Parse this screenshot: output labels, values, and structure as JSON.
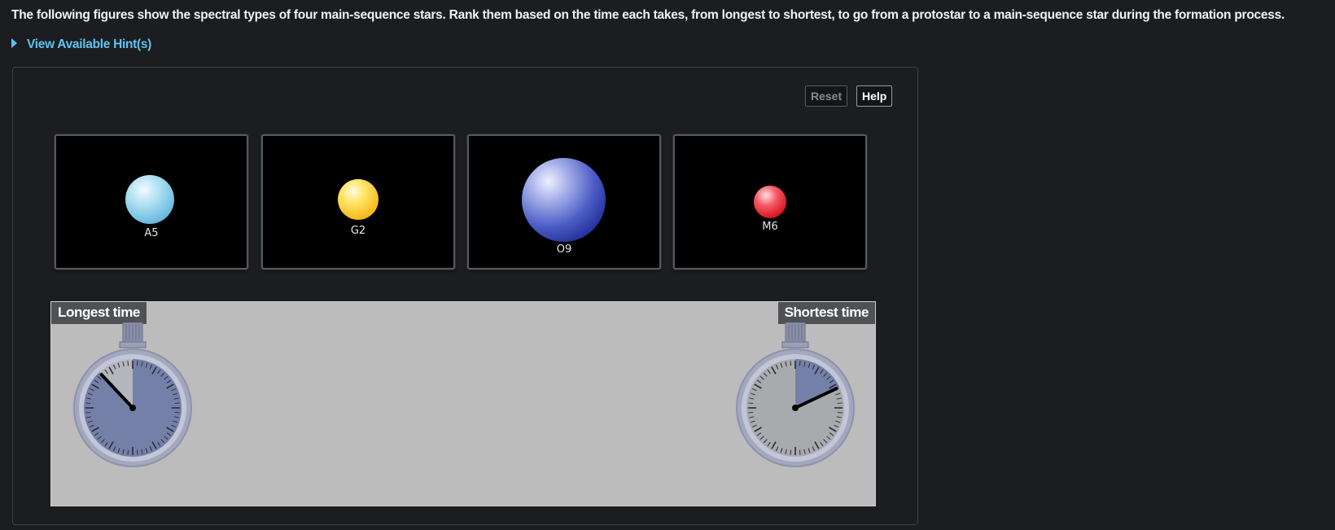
{
  "question": {
    "text": "The following figures show the spectral types of four main-sequence stars. Rank them based on the time each takes, from longest to shortest, to go from a protostar to a main-sequence star during the formation process."
  },
  "hint": {
    "label": "View Available Hint(s)",
    "icon": "triangle-right-icon",
    "color": "#5fc3ef"
  },
  "toolbar": {
    "reset_label": "Reset",
    "help_label": "Help"
  },
  "stars": [
    {
      "label": "A5",
      "color": "#8fd0ea"
    },
    {
      "label": "G2",
      "color": "#fcc82a"
    },
    {
      "label": "O9",
      "color": "#2a3aa8"
    },
    {
      "label": "M6",
      "color": "#e01f2a"
    }
  ],
  "ranking": {
    "left_label": "Longest time",
    "right_label": "Shortest time",
    "left_icon": "stopwatch-long-icon",
    "right_icon": "stopwatch-short-icon",
    "left_fill_fraction": 0.88,
    "right_fill_fraction": 0.18,
    "fill_color": "#7480a8"
  }
}
